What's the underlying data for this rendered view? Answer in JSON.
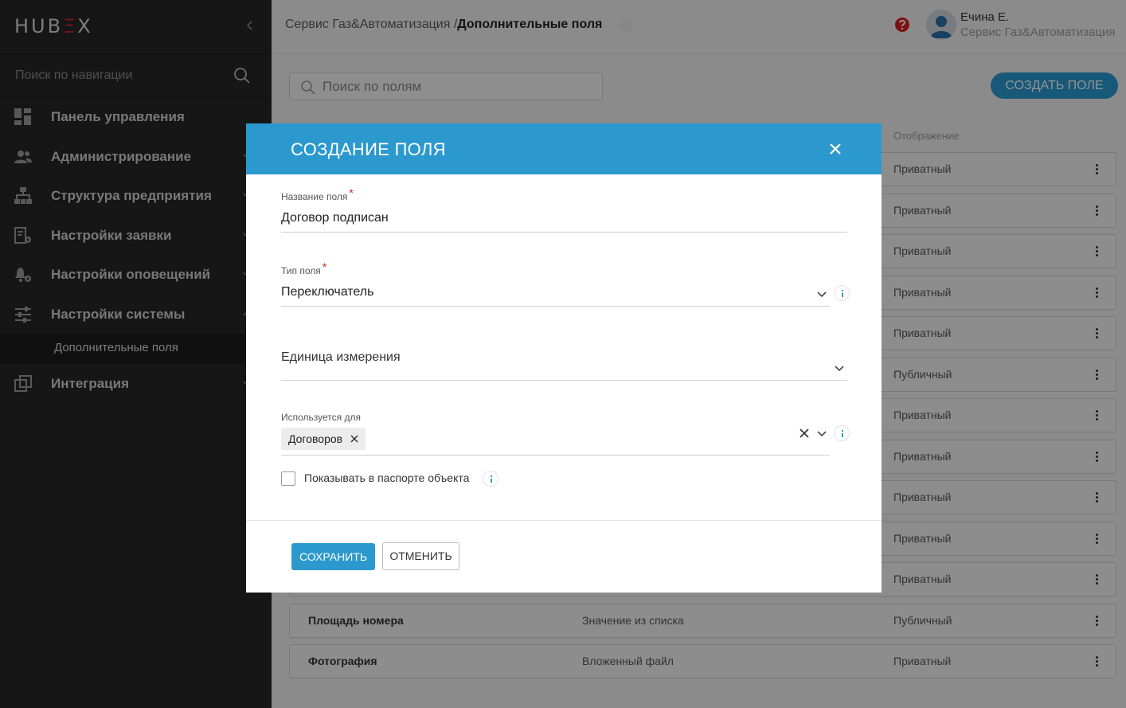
{
  "app": {
    "logo_left": "HUB",
    "logo_e": "Ξ",
    "logo_right": "X"
  },
  "sidebar": {
    "search_placeholder": "Поиск по навигации",
    "items": [
      {
        "label": "Панель управления"
      },
      {
        "label": "Администрирование"
      },
      {
        "label": "Структура предприятия"
      },
      {
        "label": "Настройки заявки"
      },
      {
        "label": "Настройки оповещений"
      },
      {
        "label": "Настройки системы"
      }
    ],
    "active_sub": "Дополнительные поля",
    "last_item": "Интеграция"
  },
  "header": {
    "breadcrumb_parent": "Сервис Газ&Автоматизация /",
    "breadcrumb_current": "Дополнительные поля",
    "user_name": "Ечина Е.",
    "user_org": "Сервис Газ&Автоматизация"
  },
  "main": {
    "search_placeholder": "Поиск по полям",
    "create_label": "СОЗДАТЬ ПОЛЕ",
    "col_display": "Отображение",
    "rows": [
      {
        "name": "",
        "type": "",
        "display": "Приватный"
      },
      {
        "name": "",
        "type": "",
        "display": "Приватный"
      },
      {
        "name": "",
        "type": "",
        "display": "Приватный"
      },
      {
        "name": "",
        "type": "",
        "display": "Приватный"
      },
      {
        "name": "",
        "type": "",
        "display": "Приватный"
      },
      {
        "name": "",
        "type": "",
        "display": "Публичный"
      },
      {
        "name": "",
        "type": "",
        "display": "Приватный"
      },
      {
        "name": "",
        "type": "",
        "display": "Приватный"
      },
      {
        "name": "",
        "type": "",
        "display": "Приватный"
      },
      {
        "name": "",
        "type": "",
        "display": "Приватный"
      },
      {
        "name": "",
        "type": "",
        "display": "Приватный"
      },
      {
        "name": "Площадь номера",
        "type": "Значение из списка",
        "display": "Публичный"
      },
      {
        "name": "Фотография",
        "type": "Вложенный файл",
        "display": "Приватный"
      }
    ]
  },
  "modal": {
    "title": "СОЗДАНИЕ ПОЛЯ",
    "name_label": "Название поля",
    "name_value": "Договор подписан",
    "type_label": "Тип поля",
    "type_value": "Переключатель",
    "unit_placeholder": "Единица измерения",
    "used_for_label": "Используется для",
    "used_for_chip": "Договоров",
    "passport_label": "Показывать в паспорте объекта",
    "required_mark": "*",
    "save_label": "СОХРАНИТЬ",
    "cancel_label": "ОТМЕНИТЬ"
  },
  "colors": {
    "accent": "#2b99cd",
    "sidebar_bg": "#262626",
    "required": "#d62020"
  }
}
